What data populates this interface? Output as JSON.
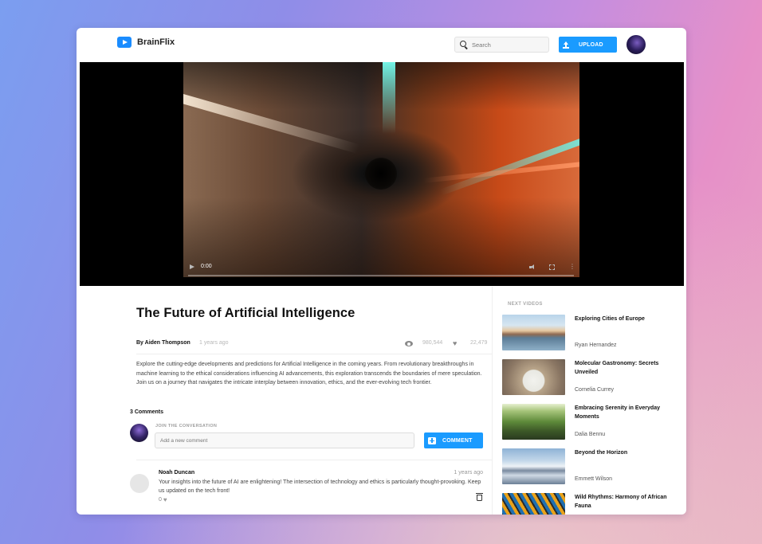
{
  "app": {
    "name": "BrainFlix"
  },
  "header": {
    "search_placeholder": "Search",
    "upload_label": "UPLOAD"
  },
  "video": {
    "current_time": "0:00",
    "title": "The Future of Artificial Intelligence",
    "author": "By Aiden Thompson",
    "posted": "1 years ago",
    "views": "980,544",
    "likes": "22,479",
    "description": "Explore the cutting-edge developments and predictions for Artificial Intelligence in the coming years. From revolutionary breakthroughs in machine learning to the ethical considerations influencing AI advancements, this exploration transcends the boundaries of mere speculation. Join us on a journey that navigates the intricate interplay between innovation, ethics, and the ever-evolving tech frontier."
  },
  "comments": {
    "count_label": "3 Comments",
    "join_label": "JOIN THE CONVERSATION",
    "input_placeholder": "Add a new comment",
    "button_label": "COMMENT",
    "items": [
      {
        "name": "Noah Duncan",
        "time": "1 years ago",
        "text": "Your insights into the future of AI are enlightening! The intersection of technology and ethics is particularly thought-provoking. Keep us updated on the tech front!",
        "likes": "0"
      }
    ]
  },
  "sidebar": {
    "label": "NEXT VIDEOS",
    "items": [
      {
        "title": "Exploring Cities of Europe",
        "author": "Ryan Hernandez"
      },
      {
        "title": "Molecular Gastronomy: Secrets Unveiled",
        "author": "Cornelia Currey"
      },
      {
        "title": "Embracing Serenity in Everyday Moments",
        "author": "Dalia Bennu"
      },
      {
        "title": "Beyond the Horizon",
        "author": "Emmett Wilson"
      },
      {
        "title": "Wild Rhythms: Harmony of African Fauna",
        "author": ""
      }
    ]
  },
  "colors": {
    "accent": "#1a9bff",
    "background_start": "#7b9ef0",
    "background_end": "#e690c8"
  },
  "icons": [
    "logo-play-icon",
    "search-icon",
    "upload-icon",
    "play-icon",
    "volume-icon",
    "fullscreen-icon",
    "more-icon",
    "eye-icon",
    "heart-icon",
    "comment-add-icon",
    "trash-icon"
  ]
}
